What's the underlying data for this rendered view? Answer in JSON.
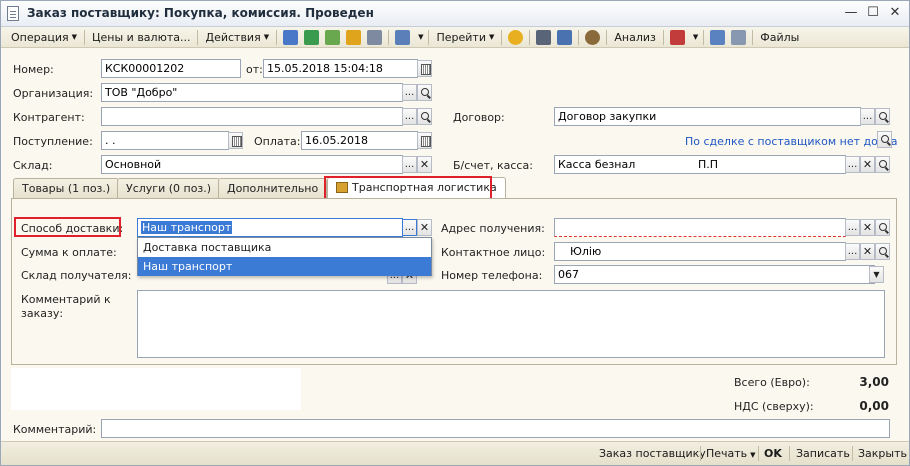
{
  "window": {
    "title": "Заказ поставщику: Покупка, комиссия. Проведен",
    "controls": {
      "min": "—",
      "max": "☐",
      "close": "✕"
    }
  },
  "toolbar": {
    "operation": "Операция",
    "prices": "Цены и валюта...",
    "actions": "Действия",
    "goto": "Перейти",
    "analysis": "Анализ",
    "files": "Файлы"
  },
  "form": {
    "number_label": "Номер:",
    "number_value": "КСК00001202",
    "from_label": "от:",
    "date_value": "15.05.2018 15:04:18",
    "org_label": "Организация:",
    "org_value": "ТОВ \"Добро\"",
    "contractor_label": "Контрагент:",
    "contractor_value": "",
    "contract_label": "Договор:",
    "contract_value": "Договор закупки",
    "receipt_label": "Поступление:",
    "receipt_value": " .  .",
    "payment_label": "Оплата:",
    "payment_value": "16.05.2018",
    "debt_link": "По сделке с поставщиком нет долга",
    "warehouse_label": "Склад:",
    "warehouse_value": "Основной",
    "account_label": "Б/счет, касса:",
    "account_value": "Касса безнал",
    "account_value2": "П.П"
  },
  "tabs": [
    {
      "label": "Товары (1 поз.)"
    },
    {
      "label": "Услуги (0 поз.)"
    },
    {
      "label": "Дополнительно"
    },
    {
      "label": "Транспортная логистика"
    }
  ],
  "logistics": {
    "delivery_label": "Способ доставки:",
    "delivery_value": "Наш транспорт",
    "delivery_options": [
      "Доставка поставщика",
      "Наш транспорт"
    ],
    "amount_label": "Сумма к оплате:",
    "recv_warehouse_label": "Склад получателя:",
    "address_label": "Адрес получения:",
    "address_value": "",
    "contact_label": "Контактное лицо:",
    "contact_value": "Юлію",
    "phone_label": "Номер телефона:",
    "phone_value": "067",
    "order_comment_label": "Комментарий к заказу:"
  },
  "totals": {
    "total_label": "Всего (Евро):",
    "total_value": "3,00",
    "vat_label": "НДС (сверху):",
    "vat_value": "0,00"
  },
  "comment": {
    "label": "Комментарий:",
    "value": ""
  },
  "bottombar": {
    "order": "Заказ поставщику",
    "print": "Печать",
    "ok": "OK",
    "save": "Записать",
    "close": "Закрыть"
  },
  "colors": {
    "accent_blue": "#3b7bd6",
    "highlight_red": "#e0202a",
    "link": "#1f56c4",
    "background": "#fbf9ef"
  }
}
